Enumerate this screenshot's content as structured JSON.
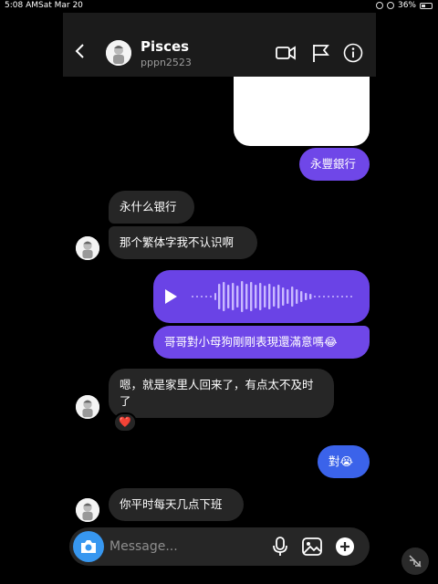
{
  "status_bar": {
    "time": "5:08 AM",
    "date": "Sat Mar 20",
    "battery": "36%"
  },
  "header": {
    "name": "Pisces",
    "username": "pppn2523"
  },
  "messages": [
    {
      "sender": "me",
      "text": "永豐銀行"
    },
    {
      "sender": "them",
      "text": "永什么银行"
    },
    {
      "sender": "them",
      "text": "那个繁体字我不认识啊"
    },
    {
      "sender": "me",
      "type": "voice"
    },
    {
      "sender": "me",
      "text": "哥哥對小母狗剛剛表現還滿意嗎😂"
    },
    {
      "sender": "them",
      "text": "嗯，就是家里人回来了，有点太不及时了"
    },
    {
      "sender": "them",
      "type": "reaction",
      "text": "❤️"
    },
    {
      "sender": "me",
      "text": "對😭"
    },
    {
      "sender": "them",
      "text": "你平时每天几点下班"
    }
  ],
  "composer": {
    "placeholder": "Message..."
  },
  "colors": {
    "sent": "#6f47e8",
    "received": "#262626",
    "camera": "#3797f0",
    "header": "#1b1b1b"
  },
  "icons": [
    "back-arrow-icon",
    "video-call-icon",
    "flag-icon",
    "info-icon",
    "camera-icon",
    "microphone-icon",
    "gallery-icon",
    "plus-icon",
    "collapse-icon"
  ]
}
